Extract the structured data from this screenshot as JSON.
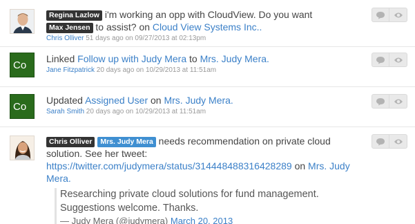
{
  "feed": [
    {
      "avatar": "person-photo",
      "mention_1": "Regina Lazlow",
      "text_1": " i'm working an opp with CloudView. Do you want ",
      "mention_2": "Max Jensen",
      "text_2": " to assist? on ",
      "link": "Cloud View Systems Inc..",
      "author": "Chris Olliver",
      "time": " 51 days ago on 09/27/2013 at 02:13pm"
    },
    {
      "avatar_initials": "Co",
      "text_1": "Linked ",
      "link_1": "Follow up with Judy Mera",
      "text_2": " to ",
      "link_2": "Mrs. Judy Mera.",
      "author": "Jane Fitzpatrick",
      "time": " 20 days ago on 10/29/2013 at 11:51am"
    },
    {
      "avatar_initials": "Co",
      "text_1": "Updated ",
      "link_1": "Assigned User",
      "text_2": " on ",
      "link_2": "Mrs. Judy Mera.",
      "author": "Sarah Smith",
      "time": " 20 days ago on 10/29/2013 at 11:51am"
    },
    {
      "avatar": "person-photo",
      "mention_1": "Chris Olliver",
      "mention_2": "Mrs. Judy Mera",
      "text_1": " needs recommendation on private cloud solution. See her tweet: ",
      "url": "https://twitter.com/judymera/status/314448488316428289",
      "text_2": " on ",
      "link": "Mrs. Judy Mera.",
      "quote_line_1": "Researching private cloud solutions for fund management.",
      "quote_line_2": "Suggestions welcome. Thanks.",
      "quote_by": "— Judy Mera (@judymera) ",
      "quote_date": "March 20, 2013"
    }
  ],
  "icons": {
    "comment": "comment-icon",
    "watch": "eye-icon"
  },
  "colors": {
    "link": "#3b80c8",
    "avatar_bg": "#2a6b1c",
    "tag_dark": "#333333",
    "tag_blue": "#3f8fd1"
  }
}
